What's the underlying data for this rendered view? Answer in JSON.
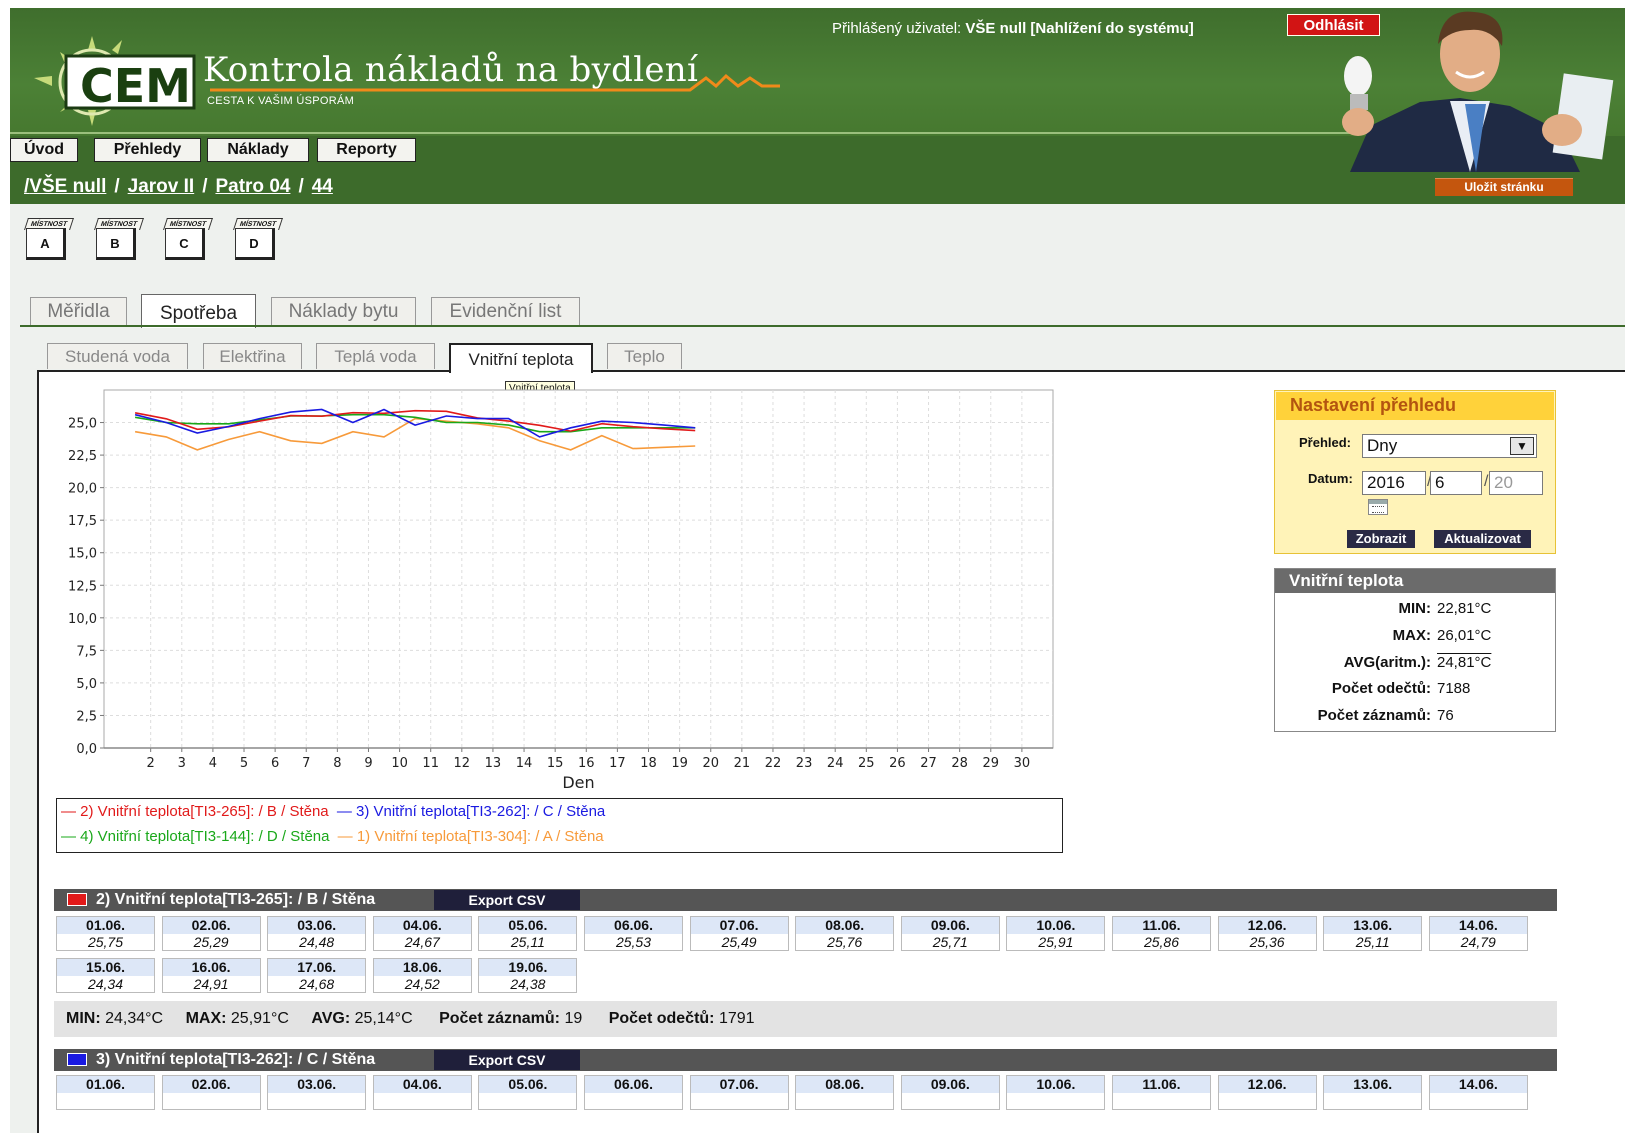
{
  "header": {
    "app_title": "Kontrola nákladů na bydlení",
    "app_subtitle": "CESTA K VAŠIM ÚSPORÁM",
    "logo_text": "CEM",
    "user_label": "Přihlášený uživatel:",
    "user_name": "VŠE null [Nahlížení do systému]",
    "logout": "Odhlásit"
  },
  "menu": [
    "Úvod",
    "Přehledy",
    "Náklady",
    "Reporty"
  ],
  "breadcrumb": {
    "lead": "/",
    "items": [
      "VŠE null",
      "Jarov II",
      "Patro 04",
      "44"
    ],
    "save": "Uložit stránku"
  },
  "rooms": {
    "caption": "MÍSTNOST",
    "items": [
      "A",
      "B",
      "C",
      "D"
    ]
  },
  "main_tabs": [
    "Měřidla",
    "Spotřeba",
    "Náklady bytu",
    "Evidenční list"
  ],
  "sub_tabs": [
    "Studená voda",
    "Elektřina",
    "Teplá voda",
    "Vnitřní teplota",
    "Teplo"
  ],
  "tooltip": "Vnitřní teplota",
  "settings": {
    "title": "Nastavení přehledu",
    "overview_label": "Přehled:",
    "overview_value": "Dny",
    "date_label": "Datum:",
    "year": "2016",
    "month": "6",
    "day_placeholder": "20",
    "show": "Zobrazit",
    "update": "Aktualizovat"
  },
  "stats": {
    "title": "Vnitřní teplota",
    "rows": [
      {
        "label": "MIN:",
        "value": "22,81°C"
      },
      {
        "label": "MAX:",
        "value": "26,01°C"
      },
      {
        "label": "AVG(aritm.):",
        "value": "24,81°C"
      },
      {
        "label": "Počet odečtů:",
        "value": "7188"
      },
      {
        "label": "Počet záznamů:",
        "value": "76"
      }
    ]
  },
  "chart_data": {
    "type": "line",
    "xlabel": "Den",
    "x_ticks": [
      2,
      3,
      4,
      5,
      6,
      7,
      8,
      9,
      10,
      11,
      12,
      13,
      14,
      15,
      16,
      17,
      18,
      19,
      20,
      21,
      22,
      23,
      24,
      25,
      26,
      27,
      28,
      29,
      30
    ],
    "y_ticks": [
      "0,0",
      "2,5",
      "5,0",
      "7,5",
      "10,0",
      "12,5",
      "15,0",
      "17,5",
      "20,0",
      "22,5",
      "25,0"
    ],
    "ylim": [
      0,
      27.5
    ],
    "xlim": [
      0.5,
      31
    ],
    "grid": true,
    "series": [
      {
        "name": "2) Vnitřní teplota[TI3-265]:  / B / Stěna",
        "color": "#e11a1a",
        "x": [
          1.5,
          2.5,
          3.5,
          4.5,
          5.5,
          6.5,
          7.5,
          8.5,
          9.5,
          10.5,
          11.5,
          12.5,
          13.5,
          14.5,
          15.5,
          16.5,
          17.5,
          18.5,
          19.5
        ],
        "values": [
          25.75,
          25.29,
          24.48,
          24.67,
          25.11,
          25.53,
          25.49,
          25.76,
          25.71,
          25.91,
          25.86,
          25.36,
          25.11,
          24.79,
          24.34,
          24.91,
          24.68,
          24.52,
          24.38
        ]
      },
      {
        "name": "3) Vnitřní teplota[TI3-262]:  / C / Stěna",
        "color": "#1a1ae1",
        "x": [
          1.5,
          2.5,
          3.5,
          4.5,
          5.5,
          6.5,
          7.5,
          8.5,
          9.5,
          10.5,
          11.5,
          12.5,
          13.5,
          14.5,
          15.5,
          16.5,
          17.5,
          18.5,
          19.5
        ],
        "values": [
          25.6,
          25.0,
          24.2,
          24.7,
          25.3,
          25.8,
          26.0,
          25.0,
          26.0,
          24.8,
          25.5,
          25.3,
          25.3,
          23.9,
          24.6,
          25.1,
          25.0,
          24.8,
          24.6
        ]
      },
      {
        "name": "4) Vnitřní teplota[TI3-144]:  / D / Stěna",
        "color": "#1aa81a",
        "x": [
          1.5,
          2.5,
          3.5,
          4.5,
          5.5,
          6.5,
          7.5,
          8.5,
          9.5,
          10.5,
          11.5,
          12.5,
          13.5,
          14.5,
          15.5,
          16.5,
          17.5,
          18.5,
          19.5
        ],
        "values": [
          25.4,
          25.0,
          24.9,
          24.9,
          25.2,
          25.5,
          25.5,
          25.6,
          25.6,
          25.4,
          25.0,
          25.0,
          24.8,
          24.3,
          24.3,
          24.6,
          24.6,
          24.6,
          24.6
        ]
      },
      {
        "name": "1) Vnitřní teplota[TI3-304]:  / A / Stěna",
        "color": "#f79a3a",
        "x": [
          1.5,
          2.5,
          3.5,
          4.5,
          5.5,
          6.5,
          7.5,
          8.5,
          9.5,
          10.5,
          11.5,
          12.5,
          13.5,
          14.5,
          15.5,
          16.5,
          17.5,
          18.5,
          19.5
        ],
        "values": [
          24.3,
          23.9,
          22.9,
          23.7,
          24.3,
          23.6,
          23.4,
          24.3,
          23.9,
          25.3,
          25.1,
          24.9,
          24.6,
          23.6,
          22.9,
          24.0,
          23.0,
          23.1,
          23.2
        ]
      }
    ]
  },
  "legend": [
    {
      "label": "2) Vnitřní teplota[TI3-265]:  / B / Stěna",
      "color": "#e11a1a"
    },
    {
      "label": "3) Vnitřní teplota[TI3-262]:  / C / Stěna",
      "color": "#1a1ae1"
    },
    {
      "label": "4) Vnitřní teplota[TI3-144]:  / D / Stěna",
      "color": "#1aa81a"
    },
    {
      "label": "1) Vnitřní teplota[TI3-304]:  / A / Stěna",
      "color": "#f79a3a"
    }
  ],
  "sections": [
    {
      "title": "2) Vnitřní teplota[TI3-265]: / B / Stěna",
      "color": "#e11a1a",
      "export": "Export CSV",
      "cells": [
        {
          "d": "01.06.",
          "v": "25,75"
        },
        {
          "d": "02.06.",
          "v": "25,29"
        },
        {
          "d": "03.06.",
          "v": "24,48"
        },
        {
          "d": "04.06.",
          "v": "24,67"
        },
        {
          "d": "05.06.",
          "v": "25,11"
        },
        {
          "d": "06.06.",
          "v": "25,53"
        },
        {
          "d": "07.06.",
          "v": "25,49"
        },
        {
          "d": "08.06.",
          "v": "25,76"
        },
        {
          "d": "09.06.",
          "v": "25,71"
        },
        {
          "d": "10.06.",
          "v": "25,91"
        },
        {
          "d": "11.06.",
          "v": "25,86"
        },
        {
          "d": "12.06.",
          "v": "25,36"
        },
        {
          "d": "13.06.",
          "v": "25,11"
        },
        {
          "d": "14.06.",
          "v": "24,79"
        },
        {
          "d": "15.06.",
          "v": "24,34"
        },
        {
          "d": "16.06.",
          "v": "24,91"
        },
        {
          "d": "17.06.",
          "v": "24,68"
        },
        {
          "d": "18.06.",
          "v": "24,52"
        },
        {
          "d": "19.06.",
          "v": "24,38"
        }
      ],
      "summary": {
        "min_label": "MIN:",
        "min": "24,34°C",
        "max_label": "MAX:",
        "max": "25,91°C",
        "avg_label": "AVG:",
        "avg": "25,14°C",
        "rec_label": "Počet záznamů:",
        "rec": "19",
        "read_label": "Počet odečtů:",
        "read": "1791"
      }
    },
    {
      "title": "3) Vnitřní teplota[TI3-262]: / C / Stěna",
      "color": "#1a1ae1",
      "export": "Export CSV",
      "cells": [
        {
          "d": "01.06."
        },
        {
          "d": "02.06."
        },
        {
          "d": "03.06."
        },
        {
          "d": "04.06."
        },
        {
          "d": "05.06."
        },
        {
          "d": "06.06."
        },
        {
          "d": "07.06."
        },
        {
          "d": "08.06."
        },
        {
          "d": "09.06."
        },
        {
          "d": "10.06."
        },
        {
          "d": "11.06."
        },
        {
          "d": "12.06."
        },
        {
          "d": "13.06."
        },
        {
          "d": "14.06."
        }
      ]
    }
  ]
}
